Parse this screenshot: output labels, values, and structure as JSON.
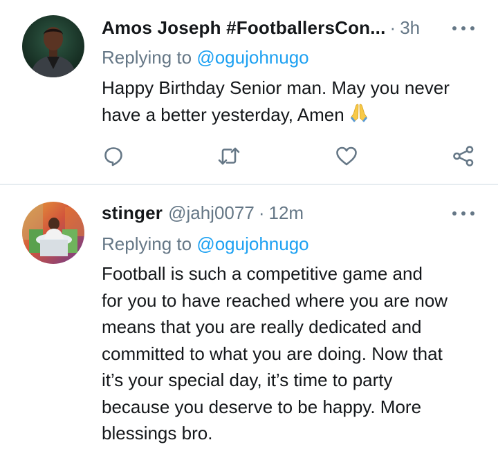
{
  "tweets": [
    {
      "display_name": "Amos Joseph #FootballersCon...",
      "handle": "",
      "separator": "·",
      "time": "3h",
      "replying_prefix": "Replying to ",
      "replying_to": "@ogujohnugo",
      "lines": [
        "Happy Birthday Senior man. May you never",
        "have a better yesterday, Amen"
      ],
      "emoji": "folded-hands",
      "actions": [
        "reply-icon",
        "retweet-icon",
        "like-icon",
        "share-icon"
      ]
    },
    {
      "display_name": "stinger",
      "handle": "@jahj0077",
      "separator": "·",
      "time": "12m",
      "replying_prefix": "Replying to ",
      "replying_to": "@ogujohnugo",
      "lines": [
        "Football is such a competitive game and",
        "for you to have reached where you are now",
        "means that you are really dedicated and",
        "committed to what you are doing. Now that",
        "it’s your special day, it’s time to party",
        "because you deserve to be happy. More",
        "blessings bro."
      ]
    }
  ],
  "colors": {
    "text": "#14171a",
    "secondary": "#657786",
    "link": "#1da1f2",
    "divider": "#e6ecf0",
    "icon": "#657786"
  }
}
